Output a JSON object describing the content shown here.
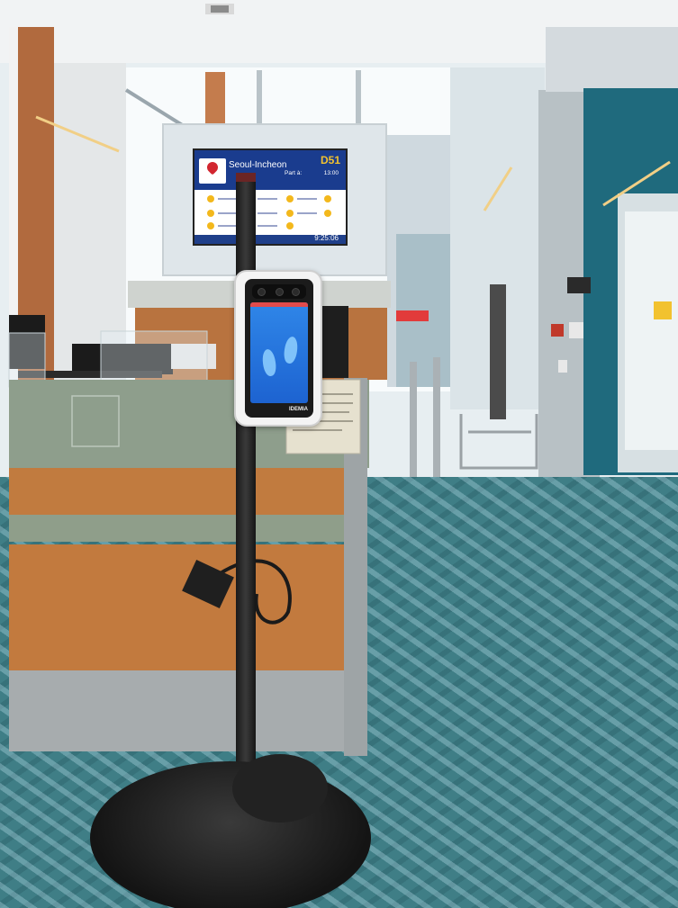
{
  "gate_display": {
    "destination": "Seoul-Incheon",
    "gate": "D51",
    "departure_label": "Part à:",
    "departure_time": "13:00",
    "clock": "9:25:06",
    "airline_logo": "maple-leaf-icon"
  },
  "kiosk": {
    "screen_icon": "footprints-icon",
    "brand": "IDEMIA"
  },
  "colors": {
    "board_blue": "#1a3c8e",
    "gate_yellow": "#f2c22f",
    "kiosk_screen": "#2f86e8",
    "carpet": "#3f7e86"
  }
}
